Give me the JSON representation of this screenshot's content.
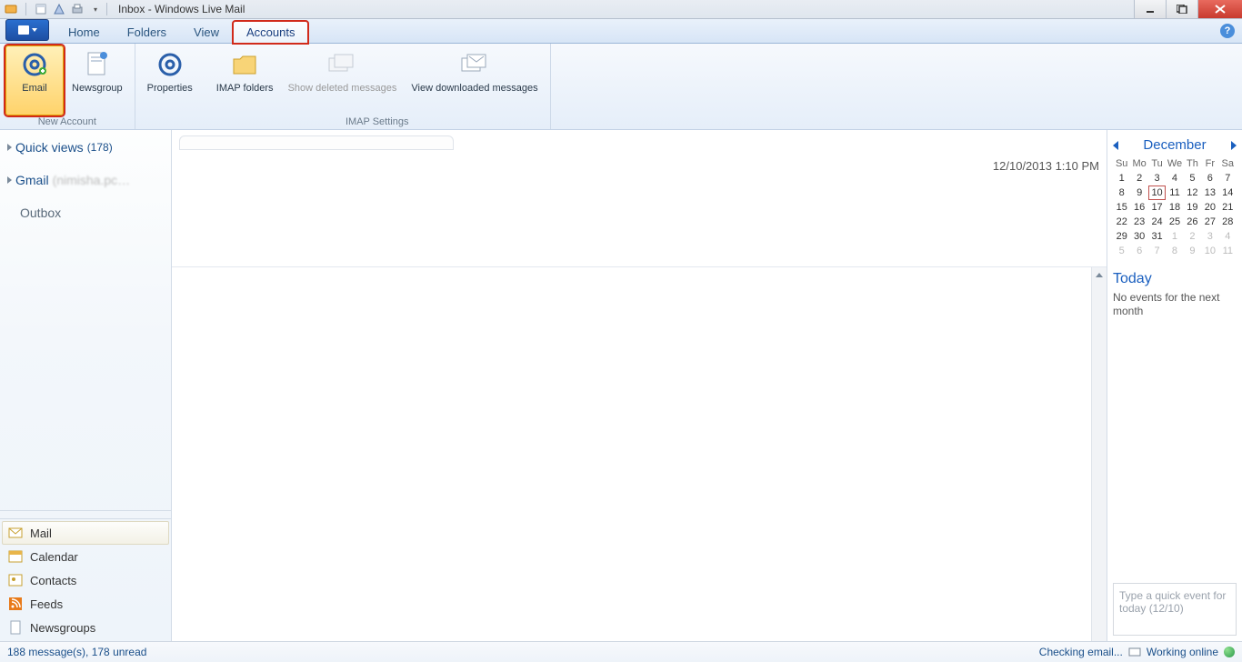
{
  "title": "Inbox - Windows Live Mail",
  "tabs": {
    "home": "Home",
    "folders": "Folders",
    "view": "View",
    "accounts": "Accounts"
  },
  "ribbon": {
    "email": "Email",
    "newsgroup": "Newsgroup",
    "properties": "Properties",
    "imap_folders": "IMAP folders",
    "show_deleted": "Show deleted messages",
    "view_downloaded": "View downloaded messages",
    "group_newaccount": "New Account",
    "group_imap": "IMAP Settings"
  },
  "nav": {
    "quick_views": "Quick views",
    "quick_views_count": "(178)",
    "gmail": "Gmail",
    "gmail_account": "(nimisha.pc…",
    "outbox": "Outbox"
  },
  "sections": {
    "mail": "Mail",
    "calendar": "Calendar",
    "contacts": "Contacts",
    "feeds": "Feeds",
    "newsgroups": "Newsgroups"
  },
  "timestamp": "12/10/2013 1:10 PM",
  "calendar": {
    "month": "December",
    "dow": [
      "Su",
      "Mo",
      "Tu",
      "We",
      "Th",
      "Fr",
      "Sa"
    ],
    "weeks": [
      [
        {
          "n": 1
        },
        {
          "n": 2
        },
        {
          "n": 3
        },
        {
          "n": 4
        },
        {
          "n": 5
        },
        {
          "n": 6
        },
        {
          "n": 7
        }
      ],
      [
        {
          "n": 8
        },
        {
          "n": 9
        },
        {
          "n": 10,
          "today": true
        },
        {
          "n": 11
        },
        {
          "n": 12
        },
        {
          "n": 13
        },
        {
          "n": 14
        }
      ],
      [
        {
          "n": 15
        },
        {
          "n": 16
        },
        {
          "n": 17
        },
        {
          "n": 18
        },
        {
          "n": 19
        },
        {
          "n": 20
        },
        {
          "n": 21
        }
      ],
      [
        {
          "n": 22
        },
        {
          "n": 23
        },
        {
          "n": 24
        },
        {
          "n": 25
        },
        {
          "n": 26
        },
        {
          "n": 27
        },
        {
          "n": 28
        }
      ],
      [
        {
          "n": 29
        },
        {
          "n": 30
        },
        {
          "n": 31
        },
        {
          "n": 1,
          "dim": true
        },
        {
          "n": 2,
          "dim": true
        },
        {
          "n": 3,
          "dim": true
        },
        {
          "n": 4,
          "dim": true
        }
      ],
      [
        {
          "n": 5,
          "dim": true
        },
        {
          "n": 6,
          "dim": true
        },
        {
          "n": 7,
          "dim": true
        },
        {
          "n": 8,
          "dim": true
        },
        {
          "n": 9,
          "dim": true
        },
        {
          "n": 10,
          "dim": true
        },
        {
          "n": 11,
          "dim": true
        }
      ]
    ],
    "today_label": "Today",
    "no_events": "No events for the next month",
    "quick_placeholder": "Type a quick event for today (12/10)"
  },
  "status": {
    "left": "188 message(s), 178 unread",
    "checking": "Checking email...",
    "online": "Working online"
  }
}
